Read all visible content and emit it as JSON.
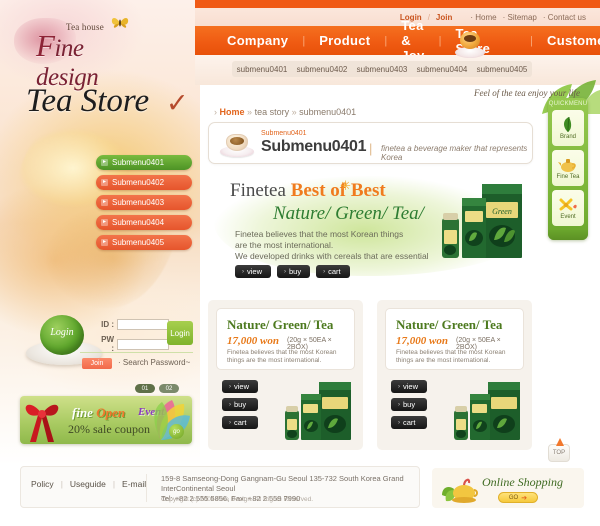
{
  "logo": {
    "teahouse": "Tea house",
    "fine": "ine design",
    "f": "F"
  },
  "page_title": "Tea Store",
  "utility": {
    "login": "Login",
    "slash": "/",
    "join": "Join",
    "home": "Home",
    "sitemap": "Sitemap",
    "contact": "Contact us"
  },
  "mainnav": [
    {
      "label": "Company"
    },
    {
      "label": "Product"
    },
    {
      "label": "Tea & Joy"
    },
    {
      "label": "Tea Store"
    },
    {
      "label": "Customer"
    }
  ],
  "submenu_top": [
    "submenu0401",
    "submenu0402",
    "submenu0403",
    "submenu0404",
    "submenu0405"
  ],
  "tagline": "Feel of the tea enjoy your life",
  "left_submenu": [
    {
      "label": "Submenu0401",
      "active": true
    },
    {
      "label": "Submenu0402",
      "active": false
    },
    {
      "label": "Submenu0403",
      "active": false
    },
    {
      "label": "Submenu0404",
      "active": false
    },
    {
      "label": "Submenu0405",
      "active": false
    }
  ],
  "login_box": {
    "cup_label": "Login",
    "id_label": "ID :",
    "pw_label": "PW :",
    "id_value": "",
    "pw_value": "",
    "login_button": "Login",
    "join_button": "Join",
    "search_password": "· Search Password~"
  },
  "event_banner": {
    "tabs": [
      "01",
      "02"
    ],
    "fine": "fine",
    "open": "Open",
    "event": "Event",
    "sale": "20% sale coupon",
    "go": "go"
  },
  "breadcrumb": {
    "arrow": "›",
    "home": "Home",
    "sep": "»",
    "tea_story": "tea story",
    "current": "submenu0401"
  },
  "title_box": {
    "small": "Submenu0401",
    "big": "Submenu0401",
    "pipe": "|",
    "desc": "finetea  a beverage maker that represents Korea"
  },
  "hero": {
    "finetea": "Finetea ",
    "best": "Best of Best",
    "subtitle": "Nature/ Green/ Tea/",
    "line1": "Finetea believes that the most Korean things",
    "line2": "are the most international.",
    "line3": "We developed drinks with cereals that are essential",
    "buttons": [
      "view",
      "buy",
      "cart"
    ]
  },
  "cards": [
    {
      "title": "Nature/ Green/ Tea",
      "price": "17,000 won",
      "spec": "(20g × 50EA × 2BOX)",
      "desc": "Finetea believes that the most Korean things are the most international.",
      "buttons": [
        "view",
        "buy",
        "cart"
      ]
    },
    {
      "title": "Nature/ Green/ Tea",
      "price": "17,000 won",
      "spec": "(20g × 50EA × 2BOX)",
      "desc": "Finetea believes that the most Korean things are the most international.",
      "buttons": [
        "view",
        "buy",
        "cart"
      ]
    }
  ],
  "quickmenu": {
    "heading": "QUICKMENU",
    "items": [
      {
        "label": "Brand",
        "icon": "leaf-icon"
      },
      {
        "label": "Fine Tea",
        "icon": "teapot-icon"
      },
      {
        "label": "Event",
        "icon": "flower-icon"
      }
    ]
  },
  "top_button": {
    "label": "TOP"
  },
  "footer": {
    "links": [
      "Policy",
      "Useguide",
      "E-mail"
    ],
    "sep": "|",
    "address1": "159-8 Samseong-Dong Gangnam-Gu Seoul 135-732 South Korea Grand InterContinental Seoul",
    "address2": "Tel: +82 2 555 5856, Fax: +82 2 559 7990",
    "copyright": "Copyright (c) 2004 Fine Design. All Rights Reserved."
  },
  "online_shopping": {
    "title": "Online Shopping",
    "go": "GO",
    "arrow": "➔"
  },
  "colors": {
    "brand_orange": "#f05a16",
    "nav_orange": "#ef5a12",
    "green_active": "#4d9325",
    "quick_green": "#79b436",
    "price_orange": "#e87a1a",
    "title_green": "#4d7a1f"
  }
}
